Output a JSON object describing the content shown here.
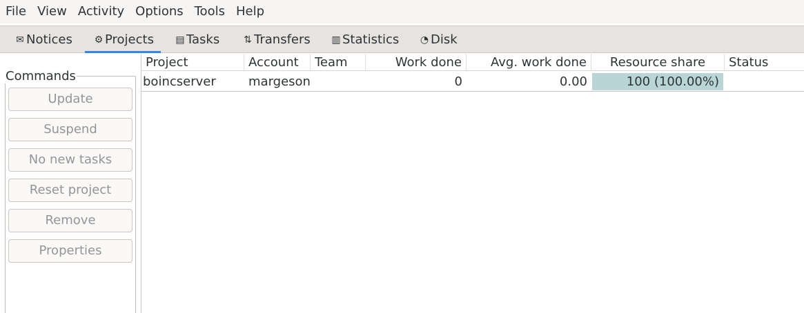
{
  "menubar": {
    "items": [
      "File",
      "View",
      "Activity",
      "Options",
      "Tools",
      "Help"
    ]
  },
  "tabs": [
    {
      "label": "Notices",
      "icon": "envelope-icon",
      "glyph": "✉"
    },
    {
      "label": "Projects",
      "icon": "gear-icon",
      "glyph": "⚙"
    },
    {
      "label": "Tasks",
      "icon": "document-icon",
      "glyph": "▤"
    },
    {
      "label": "Transfers",
      "icon": "transfer-icon",
      "glyph": "⇅"
    },
    {
      "label": "Statistics",
      "icon": "bar-chart-icon",
      "glyph": "▥"
    },
    {
      "label": "Disk",
      "icon": "pie-chart-icon",
      "glyph": "◔"
    }
  ],
  "active_tab": "Projects",
  "commands": {
    "title": "Commands",
    "buttons": [
      "Update",
      "Suspend",
      "No new tasks",
      "Reset project",
      "Remove",
      "Properties"
    ]
  },
  "table": {
    "columns": [
      "Project",
      "Account",
      "Team",
      "Work done",
      "Avg. work done",
      "Resource share",
      "Status"
    ],
    "rows": [
      {
        "project": "boincserver",
        "account": "margeson",
        "team": "",
        "work_done": "0",
        "avg_work_done": "0.00",
        "resource_share": "100 (100.00%)",
        "status": ""
      }
    ]
  },
  "colors": {
    "accent": "#3584e4",
    "resource_share_fill": "#b9d5d6",
    "disabled_text": "#949594"
  }
}
